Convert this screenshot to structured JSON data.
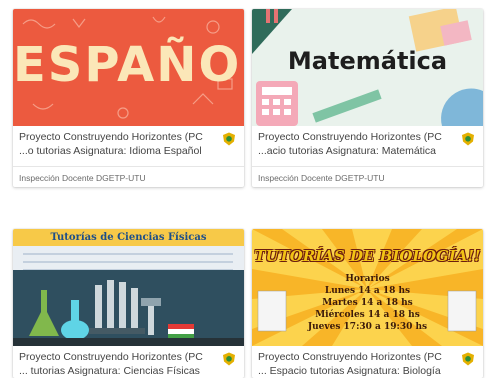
{
  "courses": [
    {
      "title_line1": "Proyecto Construyendo Horizontes (PC",
      "title_line2": "...o tutorias Asignatura: Idioma Español",
      "org": "Inspección Docente DGETP-UTU",
      "thumb_text": "ESPAÑOL"
    },
    {
      "title_line1": "Proyecto Construyendo Horizontes (PC",
      "title_line2": "...acio tutorias Asignatura: Matemática",
      "org": "Inspección Docente DGETP-UTU",
      "thumb_text": "Matemática"
    },
    {
      "title_line1": "Proyecto Construyendo Horizontes (PC",
      "title_line2": "... tutorias Asignatura: Ciencias Físicas",
      "thumb_text": "Tutorías de Ciencias Físicas"
    },
    {
      "title_line1": "Proyecto Construyendo Horizontes (PC",
      "title_line2": "... Espacio tutorias Asignatura: Biología",
      "thumb_text": "TUTORÍAS DE BIOLOGÍA!!",
      "schedule": [
        "Horarios",
        "Lunes 14 a 18 hs",
        "Martes 14 a 18 hs",
        "Miércoles 14 a 18 hs",
        "Jueves 17:30 a 19:30 hs"
      ]
    }
  ],
  "colors": {
    "badge": "#e4b000",
    "espanol_bg": "#ec5a3f",
    "matematica_bg": "#e9f2ec",
    "ciencias_banner": "#f7c948",
    "biologia_bg": "#fcd34d"
  }
}
